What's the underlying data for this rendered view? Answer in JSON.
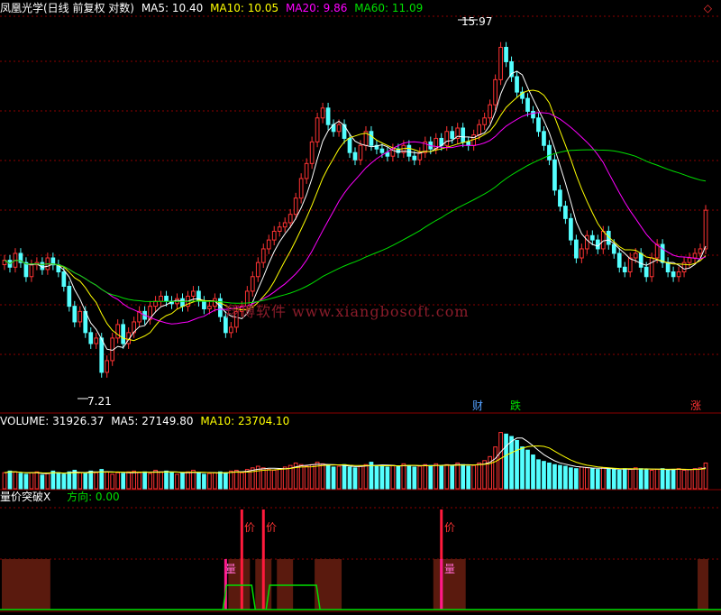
{
  "header": {
    "title": "凤凰光学(日线 前复权 对数)",
    "ma5": "MA5: 10.40",
    "ma10": "MA10: 10.05",
    "ma20": "MA20: 9.86",
    "ma60": "MA60: 11.09",
    "diamond": "◇"
  },
  "volume_header": {
    "label": "VOLUME: 31926.37",
    "ma5": "MA5: 27149.80",
    "ma10": "MA10: 23704.10"
  },
  "indicator_header": {
    "name": "量价突破X",
    "direction": "方向: 0.00"
  },
  "annotations": {
    "high": "15.97",
    "low": "7.21",
    "cai": "财",
    "die": "跌",
    "zhang": "涨",
    "jia": "价",
    "liang": "量"
  },
  "watermark": "翔博软件 www.xiangbosoft.com",
  "colors": {
    "up": "#ff3333",
    "down": "#54ffff",
    "ma5": "#ffffff",
    "ma10": "#ffff00",
    "ma20": "#ff00ff",
    "ma60": "#00e000",
    "grid": "#8b0000",
    "zone": "#5a1a0e",
    "spike": "#ff1a3c",
    "liang": "#ff1a8c"
  },
  "chart_data": [
    {
      "type": "candlestick",
      "title": "凤凰光学(日线 前复权 对数)",
      "scale": "log",
      "ylim": [
        7.0,
        16.5
      ],
      "n": 131,
      "high_mark": 15.97,
      "low_mark": 7.21,
      "close": [
        9.55,
        9.4,
        9.7,
        9.5,
        9.2,
        9.45,
        9.5,
        9.35,
        9.6,
        9.45,
        9.3,
        9.0,
        8.6,
        8.3,
        8.5,
        8.1,
        7.9,
        8.0,
        7.4,
        7.6,
        8.0,
        8.25,
        7.9,
        8.1,
        8.3,
        8.5,
        8.35,
        8.6,
        8.7,
        8.8,
        8.7,
        8.65,
        8.75,
        8.6,
        8.8,
        8.9,
        8.7,
        8.55,
        8.6,
        8.75,
        8.4,
        8.1,
        8.2,
        8.5,
        8.6,
        8.9,
        9.2,
        9.5,
        9.8,
        10.0,
        10.2,
        10.3,
        10.4,
        10.6,
        11.0,
        11.5,
        11.9,
        12.5,
        13.2,
        13.5,
        13.0,
        12.8,
        13.0,
        12.6,
        12.2,
        12.0,
        12.4,
        12.8,
        12.4,
        12.3,
        12.2,
        12.1,
        12.3,
        12.2,
        12.4,
        12.1,
        12.0,
        12.2,
        12.5,
        12.3,
        12.6,
        12.4,
        12.8,
        12.6,
        12.9,
        12.5,
        12.4,
        12.7,
        13.0,
        13.2,
        13.6,
        14.4,
        15.5,
        15.0,
        14.5,
        14.0,
        13.8,
        13.4,
        13.2,
        12.8,
        12.4,
        12.0,
        11.2,
        10.8,
        10.5,
        10.0,
        9.6,
        9.8,
        10.1,
        10.0,
        9.8,
        10.2,
        9.9,
        9.7,
        9.4,
        9.3,
        9.6,
        9.7,
        9.4,
        9.2,
        9.6,
        9.9,
        9.5,
        9.3,
        9.2,
        9.3,
        9.5,
        9.6,
        9.7,
        9.8,
        10.7
      ],
      "ma5": 10.4,
      "ma10": 10.05,
      "ma20": 9.86,
      "ma60": 11.09
    },
    {
      "type": "bar",
      "title": "VOLUME",
      "last": 31926.37,
      "ma5": 27149.8,
      "ma10": 23704.1,
      "values": [
        2.0,
        2.2,
        2.1,
        1.9,
        1.8,
        2.0,
        2.1,
        1.7,
        1.9,
        2.2,
        2.0,
        1.8,
        2.1,
        2.3,
        2.0,
        1.9,
        2.2,
        2.0,
        2.4,
        2.1,
        1.8,
        2.0,
        1.9,
        2.1,
        2.2,
        2.0,
        2.1,
        1.9,
        2.3,
        2.1,
        2.2,
        2.0,
        1.8,
        1.9,
        2.1,
        2.3,
        2.0,
        1.8,
        1.9,
        2.0,
        2.1,
        2.0,
        2.2,
        2.3,
        2.0,
        2.4,
        2.6,
        2.8,
        2.6,
        2.4,
        2.3,
        2.5,
        2.7,
        2.9,
        3.2,
        3.0,
        2.8,
        3.0,
        3.3,
        3.1,
        2.9,
        2.7,
        2.8,
        3.0,
        2.7,
        2.6,
        2.8,
        3.0,
        3.3,
        2.9,
        2.8,
        2.7,
        2.9,
        2.8,
        3.1,
        2.9,
        2.7,
        2.8,
        3.0,
        2.9,
        3.1,
        2.8,
        3.0,
        2.9,
        3.2,
        3.0,
        2.8,
        2.9,
        3.2,
        3.5,
        4.0,
        5.2,
        7.0,
        6.8,
        6.5,
        6.0,
        5.2,
        4.8,
        4.2,
        3.6,
        3.4,
        3.2,
        3.0,
        2.9,
        2.8,
        2.6,
        2.5,
        2.7,
        2.6,
        2.5,
        2.4,
        2.6,
        2.5,
        2.4,
        2.3,
        2.5,
        2.4,
        2.6,
        2.5,
        2.4,
        2.3,
        2.4,
        2.5,
        2.3,
        2.4,
        2.5,
        2.3,
        2.4,
        2.5,
        2.6,
        3.2
      ]
    },
    {
      "type": "area",
      "title": "量价突破X",
      "direction": 0.0,
      "zones": [
        [
          0,
          8
        ],
        [
          42,
          45
        ],
        [
          47,
          49
        ],
        [
          51,
          53
        ],
        [
          58,
          62
        ],
        [
          80,
          85
        ],
        [
          129,
          130
        ]
      ],
      "price_spikes": [
        44,
        48,
        81
      ],
      "volume_spikes": [
        41,
        81
      ],
      "step_segments": [
        [
          41,
          46
        ],
        [
          49,
          58
        ]
      ]
    }
  ]
}
